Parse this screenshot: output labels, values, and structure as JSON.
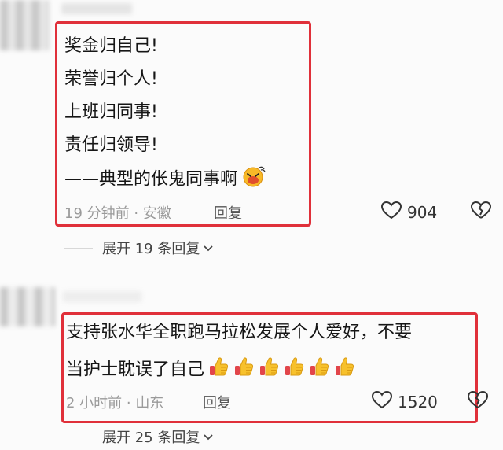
{
  "comment1": {
    "lines": [
      "奖金归自己!",
      "荣誉归个人!",
      "上班归同事!",
      "责任归领导!",
      "——典型的伥鬼同事啊"
    ],
    "emoji_icon": "grinning-face-emoji",
    "time_location": "19 分钟前 · 安徽",
    "reply_label": "回复",
    "like_count": "904",
    "expand_label": "展开 19 条回复"
  },
  "comment2": {
    "lines": [
      "支持张水华全职跑马拉松发展个人爱好，不要",
      "当护士耽误了自己"
    ],
    "emoji_icon": "thumbs-up-emoji",
    "emoji_count": 6,
    "time_location": "2 小时前 · 山东",
    "reply_label": "回复",
    "like_count": "1520",
    "expand_label": "展开 25 条回复"
  },
  "colors": {
    "highlight_frame": "#e0303a",
    "meta_text": "#9a9a9a"
  }
}
